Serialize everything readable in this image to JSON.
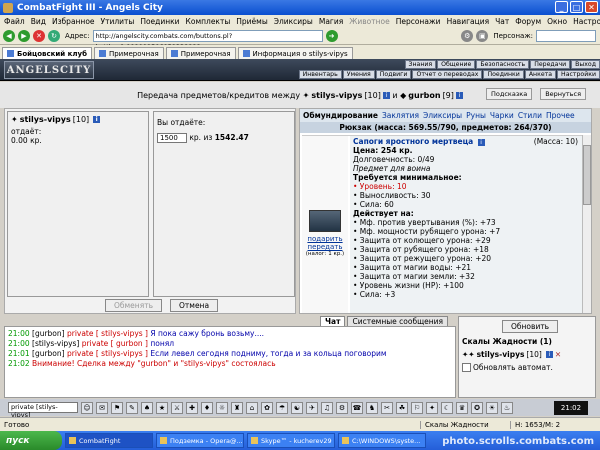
{
  "window": {
    "title": "CombatFight III - Angels City"
  },
  "menubar": {
    "items": [
      "Файл",
      "Вид",
      "Избранное",
      "Утилиты",
      "Поединки",
      "Комплекты",
      "Приёмы",
      "Эликсиры",
      "Магия",
      "Животное",
      "Персонажи",
      "Навигация",
      "Чат",
      "Форум",
      "Окно",
      "Настройки",
      "?"
    ],
    "dim_index": 9
  },
  "address": {
    "label": "Адрес:",
    "url": "http://angelscity.combats.com/buttons.pl?battle=0.009009506059338888",
    "person_label": "Персонаж:"
  },
  "tabs": [
    "Бойцовский клуб",
    "Примерочная",
    "Примерочная",
    "Информация о stilys-vipys"
  ],
  "game": {
    "logo": "ANGELSCITY",
    "menu_top": [
      "Знания",
      "Общение",
      "Безопасность",
      "Передачи",
      "Выход"
    ],
    "menu_bottom": [
      "Инвентарь",
      "Умения",
      "Подвиги",
      "Отчет о переводах",
      "Поединки",
      "Анкета",
      "Настройки"
    ]
  },
  "transfer": {
    "title": "Передача предметов/кредитов между",
    "and": "и",
    "player1": "stilys-vipys",
    "player1_level": "[10]",
    "player2": "gurbon",
    "player2_level": "[9]",
    "btn_hint": "Подсказка",
    "btn_return": "Вернуться"
  },
  "left": {
    "name": "stilys-vipys",
    "level": "[10]",
    "gives_label": "отдаёт:",
    "gives_value": "0.00 кр.",
    "you_give_label": "Вы отдаёте:",
    "you_give_value": "1500",
    "of_label": "кр. из",
    "of_value": "1542.47",
    "exchange_btn": "Обменять",
    "cancel_btn": "Отмена"
  },
  "categories": [
    "Обмундирование",
    "Заклятия",
    "Эликсиры",
    "Руны",
    "Чарки",
    "Стили",
    "Прочее"
  ],
  "backpack": "Рюкзак (масса: 569.55/790, предметов: 264/370)",
  "item": {
    "name": "Сапоги яростного мертвеца",
    "mass": "(Масса: 10)",
    "price": "Цена: 254 кр.",
    "durability": "Долговечность: 0/49",
    "purpose": "Предмет для воина",
    "req_title": "Требуется минимальное:",
    "req": [
      "• Уровень: 10",
      "• Выносливость: 30",
      "• Сила: 60"
    ],
    "acts_title": "Действует на:",
    "acts": [
      "• Мф. против увертывания (%): +73",
      "• Мф. мощности рубящего урона: +7",
      "• Защита от колющего урона: +29",
      "• Защита от рубящего урона: +18",
      "• Защита от режущего урона: +20",
      "• Защита от магии воды: +21",
      "• Защита от магии земли: +32",
      "• Уровень жизни (HP): +100",
      "• Сила: +3"
    ],
    "gift": "подарить",
    "give": "передать",
    "tax": "(налог: 1 кр.)"
  },
  "chat": {
    "tab_chat": "Чат",
    "tab_sys": "Системные сообщения",
    "lines": [
      {
        "time": "21:00",
        "user": "[gurbon]",
        "pm": "private [ stilys-vipys ]",
        "msg": "Я пока сажу бронь возьму...."
      },
      {
        "time": "21:00",
        "user": "[stilys-vipys]",
        "pm": "private [ gurbon ]",
        "msg": "понял"
      },
      {
        "time": "21:01",
        "user": "[gurbon]",
        "pm": "private [ stilys-vipys ]",
        "msg": "Если левел сегодня подниму, тогда и за кольца поговорим"
      },
      {
        "time": "21:02",
        "user": "",
        "pm": "",
        "msg": "Внимание! Сделка между \"gurbon\" и \"stilys-vipys\" состоялась"
      }
    ]
  },
  "greed": {
    "btn": "Обновить",
    "title": "Скалы Жадности (1)",
    "player": "stilys-vipys",
    "level": "[10]",
    "auto": "Обновлять автомат."
  },
  "bottom": {
    "chat_input": "private [stilys-vipys]",
    "clock": "21:02"
  },
  "status": {
    "ready": "Готово",
    "loc": "Скалы Жадности",
    "hp": "Н: 1653/М: 2"
  },
  "taskbar": {
    "start": "пуск",
    "items": [
      "CombatFight",
      "Подземка - Opera@...",
      "Skype™ - kucherev29",
      "C:\\WINDOWS\\syste..."
    ]
  },
  "watermark": "photo.scrolls.combats.com"
}
